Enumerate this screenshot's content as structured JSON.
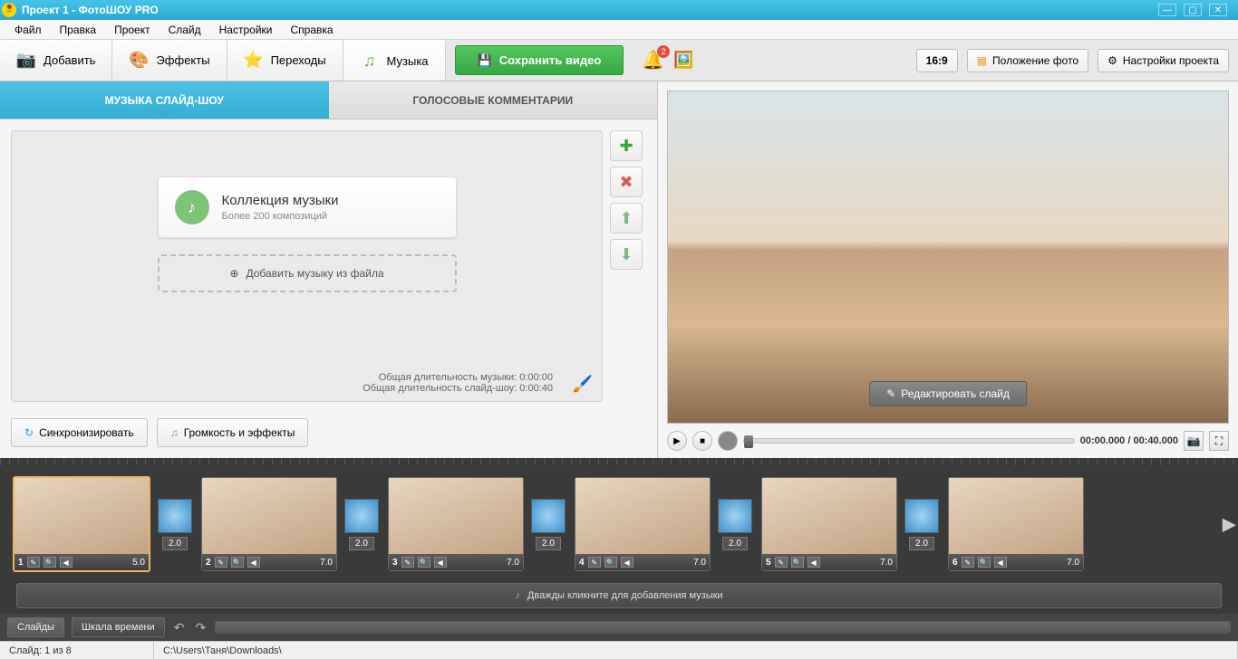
{
  "title": "Проект 1 - ФотоШОУ PRO",
  "menu": {
    "file": "Файл",
    "edit": "Правка",
    "project": "Проект",
    "slide": "Слайд",
    "settings": "Настройки",
    "help": "Справка"
  },
  "tabs": {
    "add": "Добавить",
    "effects": "Эффекты",
    "transitions": "Переходы",
    "music": "Музыка"
  },
  "save_btn": "Сохранить видео",
  "notif_count": "2",
  "aspect": "16:9",
  "position_btn": "Положение фото",
  "proj_settings_btn": "Настройки проекта",
  "subtabs": {
    "music": "МУЗЫКА СЛАЙД-ШОУ",
    "voice": "ГОЛОСОВЫЕ КОММЕНТАРИИ"
  },
  "collection": {
    "title": "Коллекция музыки",
    "subtitle": "Более 200 композиций"
  },
  "add_music_file": "Добавить музыку из файла",
  "duration": {
    "music_label": "Общая длительность музыки: ",
    "music_val": "0:00:00",
    "show_label": "Общая длительность слайд-шоу: ",
    "show_val": "0:00:40"
  },
  "sync_btn": "Синхронизировать",
  "volume_btn": "Громкость и эффекты",
  "edit_slide": "Редактировать слайд",
  "timecode": "00:00.000 / 00:40.000",
  "timeline_hint": "Дважды кликните для добавления музыки",
  "tf": {
    "slides": "Слайды",
    "scale": "Шкала времени"
  },
  "status": {
    "slide": "Слайд: 1 из 8",
    "path": "C:\\Users\\Таня\\Downloads\\"
  },
  "slides": [
    {
      "n": "1",
      "dur": "5.0",
      "trans": "2.0"
    },
    {
      "n": "2",
      "dur": "7.0",
      "trans": "2.0"
    },
    {
      "n": "3",
      "dur": "7.0",
      "trans": "2.0"
    },
    {
      "n": "4",
      "dur": "7.0",
      "trans": "2.0"
    },
    {
      "n": "5",
      "dur": "7.0",
      "trans": "2.0"
    },
    {
      "n": "6",
      "dur": "7.0",
      "trans": null
    }
  ]
}
